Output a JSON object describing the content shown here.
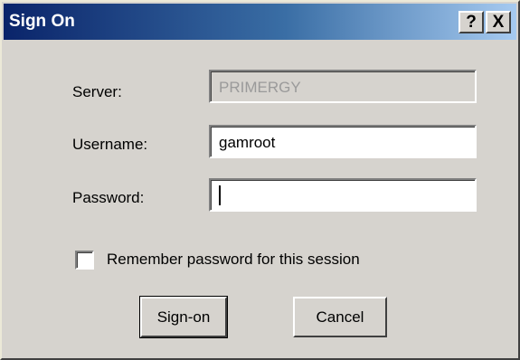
{
  "window": {
    "title": "Sign On",
    "help_glyph": "?",
    "close_glyph": "X"
  },
  "form": {
    "server": {
      "label": "Server:",
      "value": "PRIMERGY"
    },
    "username": {
      "label": "Username:",
      "value": "gamroot"
    },
    "password": {
      "label": "Password:",
      "value": ""
    }
  },
  "remember": {
    "label": "Remember password for this session",
    "checked": false
  },
  "buttons": {
    "signon_label": "Sign-on",
    "cancel_label": "Cancel"
  },
  "colors": {
    "dialog_bg": "#d6d3ce",
    "titlebar_start": "#0a246a",
    "titlebar_end": "#a6caf0",
    "disabled_text": "#9a9a9a"
  },
  "icons": {
    "help": "help-icon",
    "close": "close-icon",
    "checkbox": "checkbox-unchecked"
  }
}
